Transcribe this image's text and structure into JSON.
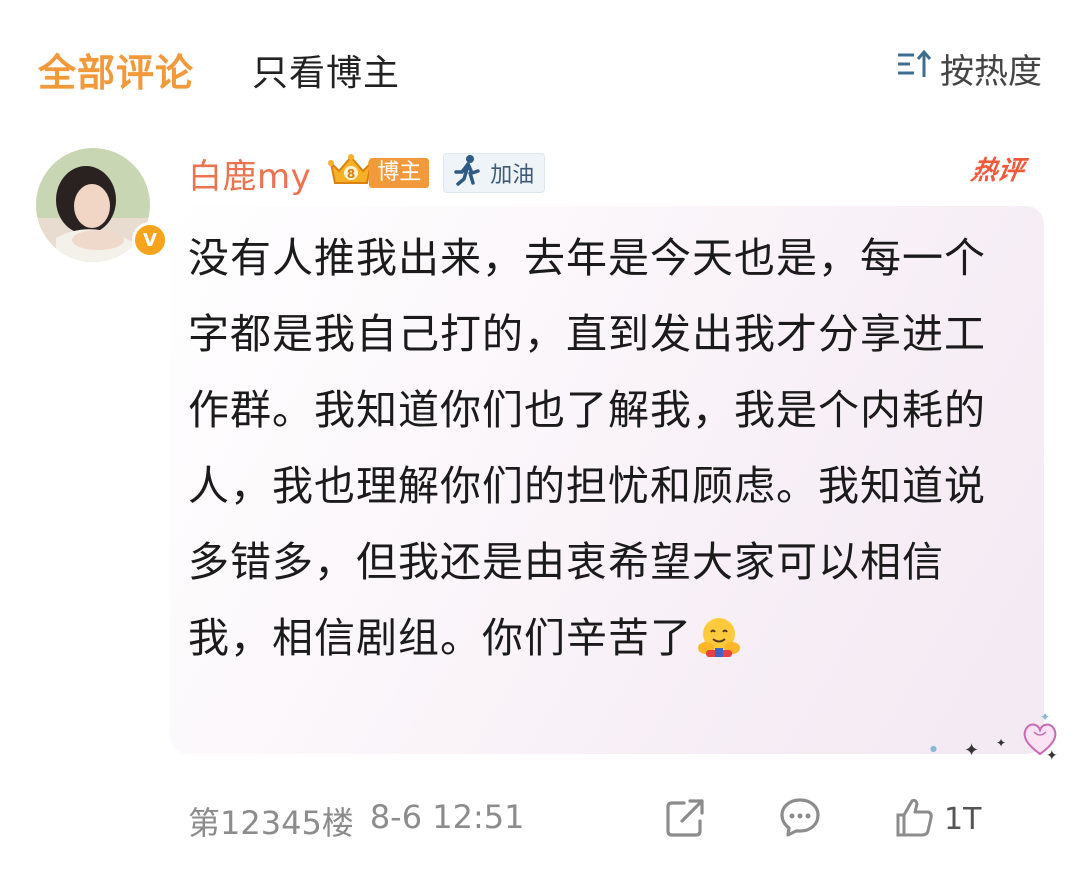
{
  "header": {
    "tab_all": "全部评论",
    "tab_owner": "只看博主",
    "sort_label": "按热度"
  },
  "comment": {
    "username": "白鹿my",
    "blogger_tag": "博主",
    "cheer_label": "加油",
    "hot_tag": "热评",
    "text": "没有人推我出来，去年是今天也是，每一个字都是我自己打的，直到发出我才分享进工作群。我知道你们也了解我，我是个内耗的人，我也理解你们的担忧和顾虑。我知道说多错多，但我还是由衷希望大家可以相信我，相信剧组。你们辛苦了",
    "floor": "第12345楼",
    "time": "8-6 12:51",
    "emoji": "hug-emoji",
    "like_count": "1T"
  },
  "colors": {
    "accent": "#f29a3b",
    "username": "#eb7350",
    "hot": "#f05a3a",
    "meta": "#8c8c8c"
  }
}
